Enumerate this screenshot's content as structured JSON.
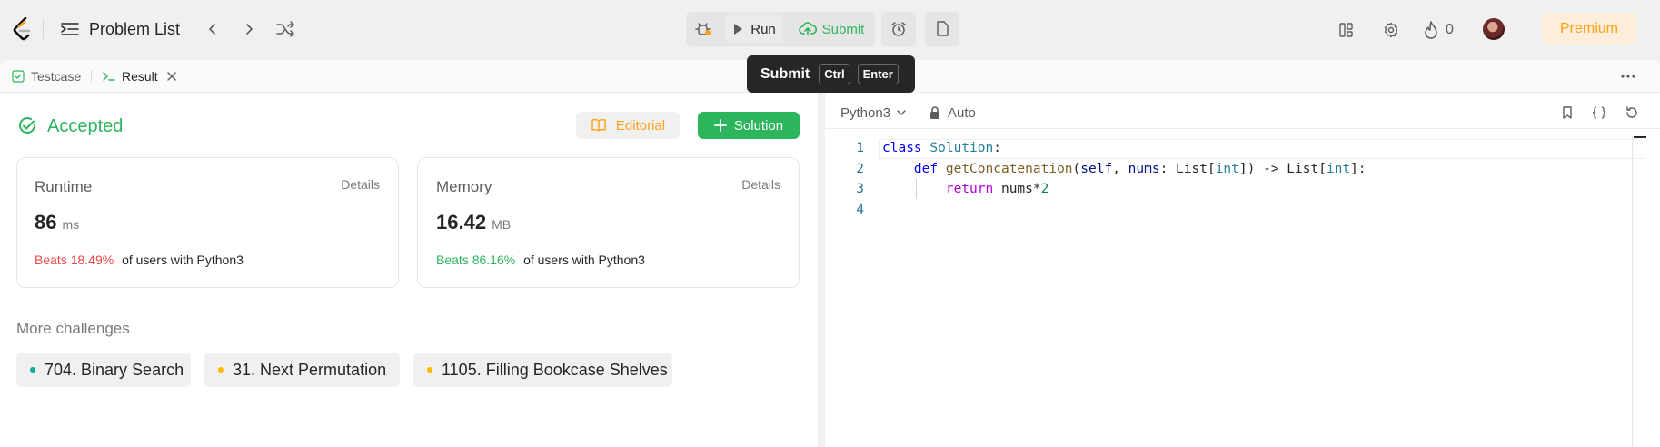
{
  "header": {
    "problem_list_label": "Problem List",
    "run_label": "Run",
    "submit_label": "Submit",
    "streak_count": "0",
    "premium_label": "Premium"
  },
  "tooltip": {
    "title": "Submit",
    "key1": "Ctrl",
    "key2": "Enter"
  },
  "left_tabs": {
    "testcase": "Testcase",
    "result": "Result"
  },
  "result": {
    "status": "Accepted",
    "editorial_label": "Editorial",
    "solution_label": "Solution",
    "runtime": {
      "title": "Runtime",
      "details": "Details",
      "value": "86",
      "unit": "ms",
      "beats": "Beats 18.49%",
      "suffix": "of users with Python3"
    },
    "memory": {
      "title": "Memory",
      "details": "Details",
      "value": "16.42",
      "unit": "MB",
      "beats": "Beats 86.16%",
      "suffix": "of users with Python3"
    }
  },
  "challenges": {
    "heading": "More challenges",
    "items": [
      {
        "label": "704. Binary Search",
        "color": "#00af9b"
      },
      {
        "label": "31. Next Permutation",
        "color": "#ffb800"
      },
      {
        "label": "1105. Filling Bookcase Shelves",
        "color": "#ffb800"
      }
    ]
  },
  "editor": {
    "language": "Python3",
    "mode": "Auto",
    "line_numbers": [
      "1",
      "2",
      "3",
      "4"
    ],
    "code": {
      "l1_kw": "class",
      "l1_cls": "Solution",
      "l1_end": ":",
      "l2_kw": "def",
      "l2_fn": "getConcatenation",
      "l2_a": "(",
      "l2_self": "self",
      "l2_b": ", ",
      "l2_nums": "nums",
      "l2_c": ": List[",
      "l2_int1": "int",
      "l2_d": "]) -> List[",
      "l2_int2": "int",
      "l2_e": "]:",
      "l3_kw": "return",
      "l3_a": " nums*",
      "l3_num": "2"
    }
  },
  "colors": {
    "accent_green": "#2db55d",
    "accent_orange": "#ffa116",
    "beats_red": "#ef4743"
  }
}
